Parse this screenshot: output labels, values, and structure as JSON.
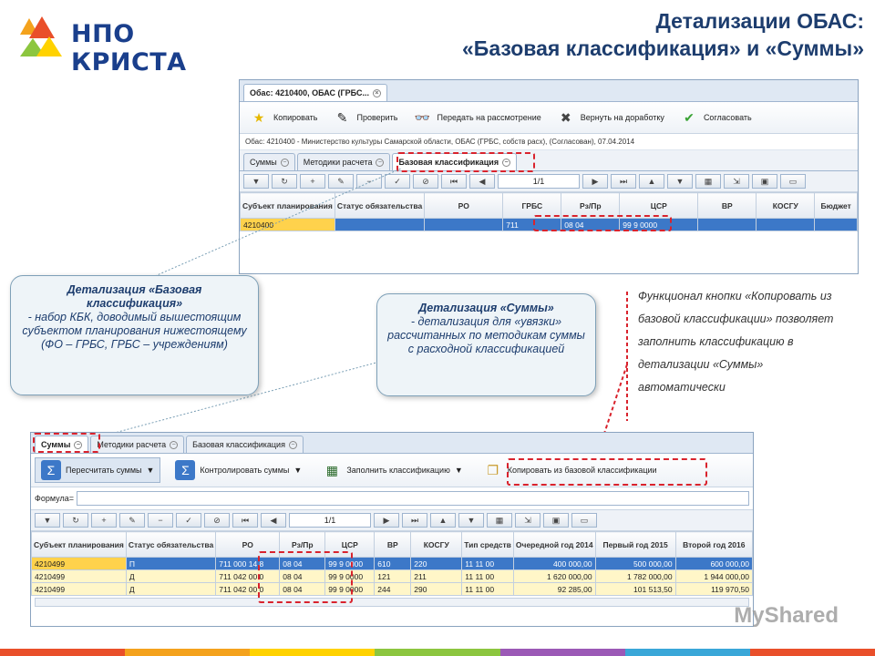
{
  "logo": {
    "text": "НПО КРИСТА"
  },
  "title": {
    "line1": "Детализации ОБАС:",
    "line2": "«Базовая классификация» и «Суммы»"
  },
  "top_window": {
    "tab_title": "Обас: 4210400, ОБАС (ГРБС...",
    "toolbar": [
      "Копировать",
      "Проверить",
      "Передать на рассмотрение",
      "Вернуть на доработку",
      "Согласовать"
    ],
    "info": "Обас: 4210400 - Министерство культуры Самарской области, ОБАС (ГРБС, собств расх), (Согласован), 07.04.2014",
    "subtabs": [
      "Суммы",
      "Методики расчета",
      "Базовая классификация"
    ],
    "page": "1/1",
    "columns": [
      "Субъект планирования",
      "Статус обязательства",
      "РО",
      "ГРБС",
      "Рз/Пр",
      "ЦСР",
      "ВР",
      "КОСГУ",
      "Бюджет"
    ],
    "row": [
      "4210400",
      "",
      "",
      "711",
      "08 04",
      "99 9 0000",
      "",
      "",
      ""
    ]
  },
  "bubble_left": {
    "title": "Детализация «Базовая классификация»",
    "body": "- набор КБК, доводимый вышестоящим субъектом планирования нижестоящему (ФО – ГРБС, ГРБС – учреждениям)"
  },
  "bubble_mid": {
    "title": "Детализация «Суммы»",
    "body": "- детализация для «увязки» рассчитанных по методикам суммы с расходной классификацией"
  },
  "note": "Функционал кнопки «Копировать из базовой классификации» позволяет заполнить классификацию в детализации «Суммы» автоматически",
  "bottom_window": {
    "tabs": [
      "Суммы",
      "Методики расчета",
      "Базовая классификация"
    ],
    "toolbar": [
      "Пересчитать суммы",
      "Контролировать суммы",
      "Заполнить классификацию",
      "Копировать из базовой классификации"
    ],
    "formula_label": "Формула=",
    "page": "1/1",
    "columns": [
      "Субъект планирования",
      "Статус обязательства",
      "РО",
      "Рз/Пр",
      "ЦСР",
      "ВР",
      "КОСГУ",
      "Тип средств",
      "Очередной год 2014",
      "Первый год 2015",
      "Второй год 2016"
    ],
    "rows": [
      [
        "4210499",
        "П",
        "711 000 14 8",
        "08 04",
        "99 9 0000",
        "610",
        "220",
        "11 11 00",
        "400 000,00",
        "500 000,00",
        "600 000,00"
      ],
      [
        "4210499",
        "Д",
        "711 042 00 0",
        "08 04",
        "99 9 0000",
        "121",
        "211",
        "11 11 00",
        "1 620 000,00",
        "1 782 000,00",
        "1 944 000,00"
      ],
      [
        "4210499",
        "Д",
        "711 042 00 0",
        "08 04",
        "99 9 0000",
        "244",
        "290",
        "11 11 00",
        "92 285,00",
        "101 513,50",
        "119 970,50"
      ]
    ]
  },
  "watermark": "MyShared"
}
